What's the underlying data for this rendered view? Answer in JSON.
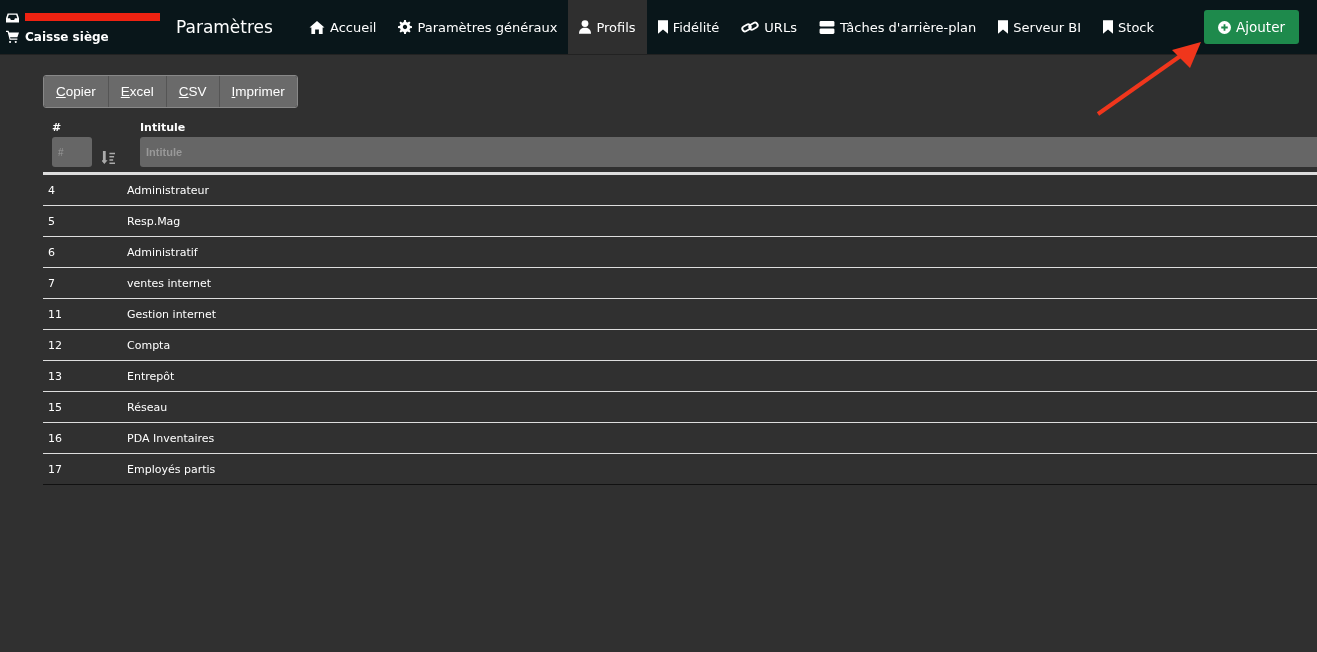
{
  "header": {
    "store": "Caisse siège",
    "title": "Paramètres"
  },
  "nav": [
    {
      "label": "Accueil",
      "kind": "home",
      "selected": false
    },
    {
      "label": "Paramètres généraux",
      "kind": "settings",
      "selected": false
    },
    {
      "label": "Profils",
      "kind": "profile",
      "selected": true
    },
    {
      "label": "Fidélité",
      "kind": "page",
      "selected": false
    },
    {
      "label": "URLs",
      "kind": "web",
      "selected": false
    },
    {
      "label": "Tâches d'arrière-plan",
      "kind": "tasks",
      "selected": false
    },
    {
      "label": "Serveur BI",
      "kind": "page",
      "selected": false
    },
    {
      "label": "Stock",
      "kind": "page",
      "selected": false
    }
  ],
  "add_button": "Ajouter",
  "export_buttons": [
    "Copier",
    "Excel",
    "CSV",
    "Imprimer"
  ],
  "table": {
    "columns": [
      {
        "label": "#",
        "placeholder": "#"
      },
      {
        "label": "Intitule",
        "placeholder": "Intitule"
      }
    ],
    "rows": [
      [
        "4",
        "Administrateur"
      ],
      [
        "5",
        "Resp.Mag"
      ],
      [
        "6",
        "Administratif"
      ],
      [
        "7",
        "ventes internet"
      ],
      [
        "11",
        "Gestion internet"
      ],
      [
        "12",
        "Compta"
      ],
      [
        "13",
        "Entrepôt"
      ],
      [
        "15",
        "Réseau"
      ],
      [
        "16",
        "PDA Inventaires"
      ],
      [
        "17",
        "Employés partis"
      ]
    ]
  }
}
